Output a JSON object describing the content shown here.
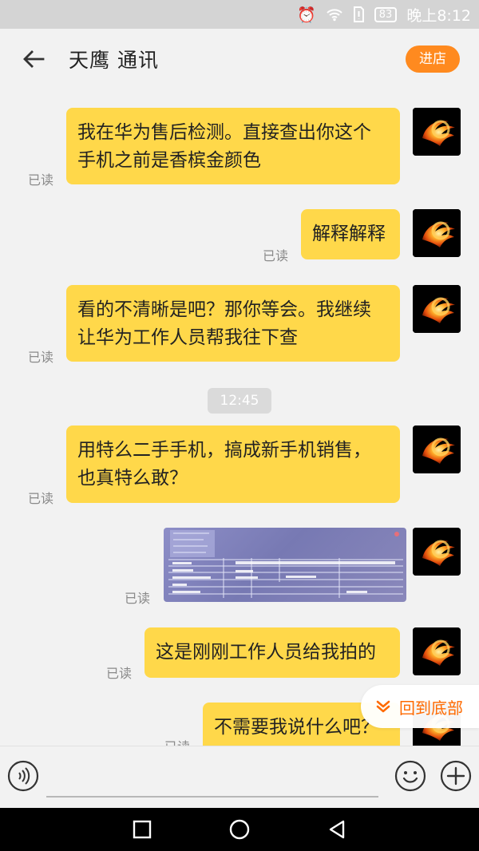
{
  "status_bar": {
    "battery": "83",
    "time": "晚上8:12",
    "icons": [
      "alarm-icon",
      "wifi-icon",
      "no-sim-icon",
      "battery-icon"
    ]
  },
  "header": {
    "title": "天鹰 通讯",
    "store_button": "进店"
  },
  "messages": [
    {
      "text_line1": "我在华为售后检测。直接查出你这个",
      "text_line2": "手机之前是香槟金颜色",
      "status": "已读"
    },
    {
      "text": "解释解释",
      "status": "已读"
    },
    {
      "text_line1": "看的不清晰是吧？那你等会。我继续",
      "text_line2": "让华为工作人员帮我往下查",
      "status": "已读"
    },
    {
      "time": "12:45"
    },
    {
      "text_line1": "用特么二手手机，搞成新手机销售，",
      "text_line2": "也真特么敢？",
      "status": "已读"
    },
    {
      "type": "image",
      "status": "已读"
    },
    {
      "text": "这是刚刚工作人员给我拍的",
      "status": "已读"
    },
    {
      "text": "不需要我说什么吧？",
      "status": "已读"
    }
  ],
  "back_to_bottom": "回到底部",
  "input_bar": {
    "voice_icon": "voice-icon",
    "emoji_icon": "emoji-icon",
    "add_icon": "add-icon"
  },
  "colors": {
    "bubble": "#ffd84a",
    "accent": "#ff8a1f",
    "text": "#222222"
  }
}
